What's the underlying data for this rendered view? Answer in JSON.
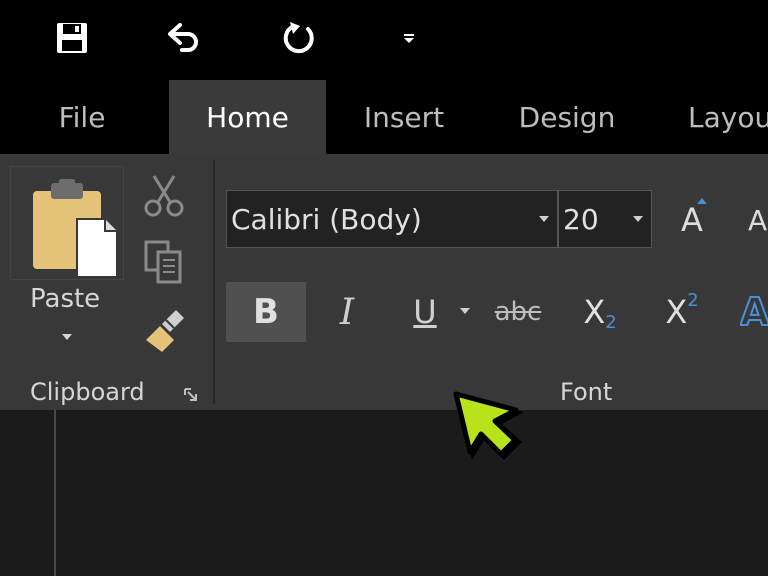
{
  "quick_access": {
    "save_icon": "save-icon",
    "undo_icon": "undo-icon",
    "redo_icon": "redo-icon",
    "customize_icon": "customize-dropdown-icon"
  },
  "tabs": [
    {
      "label": "File",
      "active": false
    },
    {
      "label": "Home",
      "active": true
    },
    {
      "label": "Insert",
      "active": false
    },
    {
      "label": "Design",
      "active": false
    },
    {
      "label": "Layou",
      "active": false
    }
  ],
  "clipboard": {
    "paste_label": "Paste",
    "group_label": "Clipboard",
    "cut_icon": "scissors-icon",
    "copy_icon": "copy-icon",
    "format_painter_icon": "paintbrush-icon",
    "launcher_icon": "dialog-launcher-icon"
  },
  "font": {
    "font_name": "Calibri (Body)",
    "font_size": "20",
    "grow_label": "A",
    "grow_partial_label": "A",
    "bold_label": "B",
    "italic_label": "I",
    "underline_label": "U",
    "strike_label": "abc",
    "subscript_base": "X",
    "subscript_digit": "2",
    "superscript_base": "X",
    "superscript_digit": "2",
    "effects_label": "A",
    "group_label": "Font"
  },
  "colors": {
    "accent_blue": "#4a90d9",
    "cursor_green": "#b8e21a",
    "ribbon_bg": "#383838",
    "active_tab_bg": "#3a3a3a"
  }
}
